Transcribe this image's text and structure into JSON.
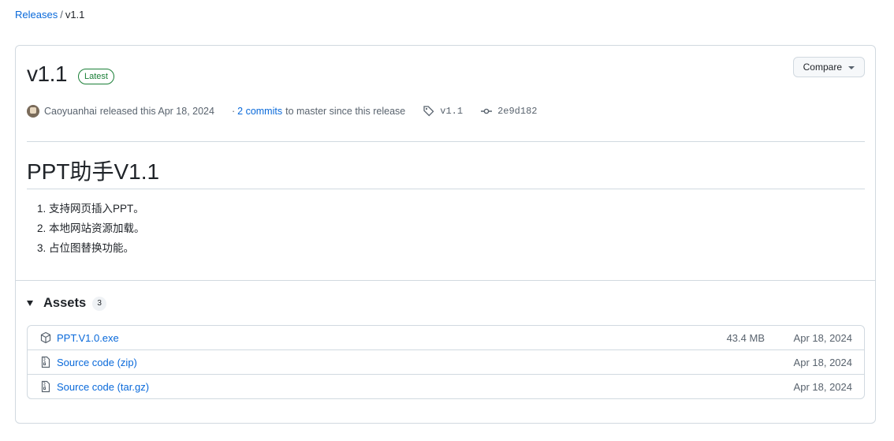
{
  "breadcrumb": {
    "parent": "Releases",
    "separator": "/",
    "current": "v1.1"
  },
  "release": {
    "version": "v1.1",
    "badge": "Latest",
    "compare_label": "Compare",
    "author": "Caoyuanhai",
    "released_text": "released this Apr 18, 2024",
    "commits_prefix": "·",
    "commits_link": "2 commits",
    "commits_suffix": "to master since this release",
    "tag": "v1.1",
    "commit_sha": "2e9d182",
    "heading": "PPT助手V1.1",
    "notes": [
      "支持网页插入PPT。",
      "本地网站资源加载。",
      "占位图替换功能。"
    ]
  },
  "assets": {
    "title": "Assets",
    "count": "3",
    "items": [
      {
        "icon": "package-icon",
        "name": "PPT.V1.0.exe",
        "size": "43.4 MB",
        "date": "Apr 18, 2024"
      },
      {
        "icon": "file-zip-icon",
        "name": "Source code (zip)",
        "size": "",
        "date": "Apr 18, 2024"
      },
      {
        "icon": "file-zip-icon",
        "name": "Source code (tar.gz)",
        "size": "",
        "date": "Apr 18, 2024"
      }
    ]
  },
  "colors": {
    "link": "#0969da",
    "latest_badge": "#1a7f37",
    "border": "#d1d9e0",
    "muted": "#59636e"
  }
}
